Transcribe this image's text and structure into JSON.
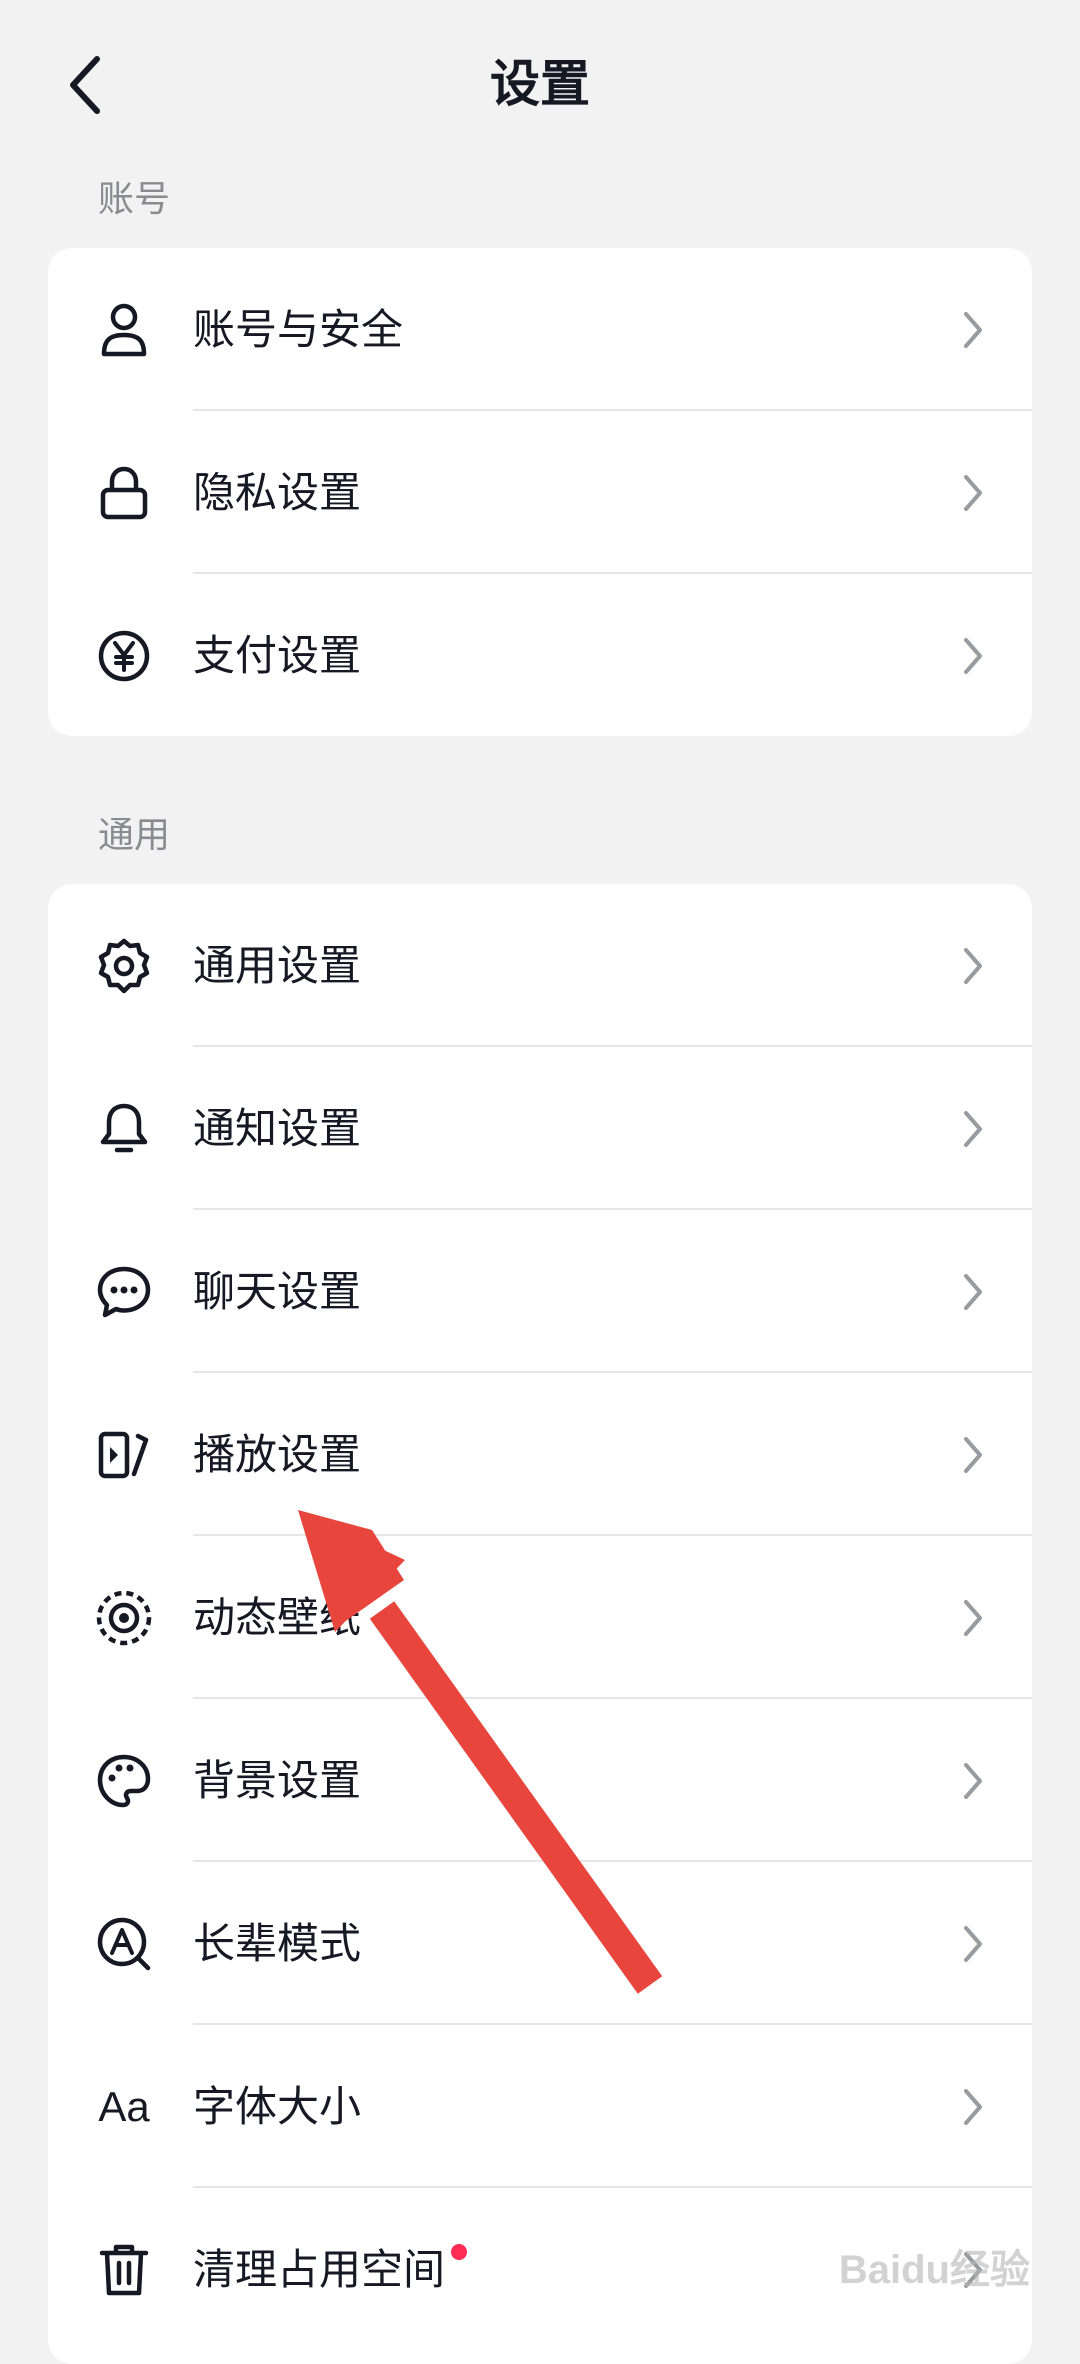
{
  "header": {
    "title": "设置",
    "back_icon": "chevron-left-icon"
  },
  "sections": [
    {
      "label": "账号",
      "items": [
        {
          "label": "账号与安全",
          "icon": "user-icon"
        },
        {
          "label": "隐私设置",
          "icon": "lock-icon"
        },
        {
          "label": "支付设置",
          "icon": "yuan-icon"
        }
      ]
    },
    {
      "label": "通用",
      "items": [
        {
          "label": "通用设置",
          "icon": "gear-icon"
        },
        {
          "label": "通知设置",
          "icon": "bell-icon"
        },
        {
          "label": "聊天设置",
          "icon": "chat-icon"
        },
        {
          "label": "播放设置",
          "icon": "play-icon"
        },
        {
          "label": "动态壁纸",
          "icon": "live-wallpaper-icon"
        },
        {
          "label": "背景设置",
          "icon": "palette-icon"
        },
        {
          "label": "长辈模式",
          "icon": "elder-mode-icon"
        },
        {
          "label": "字体大小",
          "icon": "font-size-icon",
          "icon_text": "Aa"
        },
        {
          "label": "清理占用空间",
          "icon": "trash-icon",
          "badge": "red-dot"
        }
      ]
    }
  ],
  "colors": {
    "background": "#f2f2f2",
    "card": "#ffffff",
    "text": "#161823",
    "section_label": "#8a8b91",
    "chevron": "#9a9ba0",
    "badge": "#fe2c55",
    "annotation_arrow": "#e8453c"
  },
  "watermark": "Baidu经验"
}
